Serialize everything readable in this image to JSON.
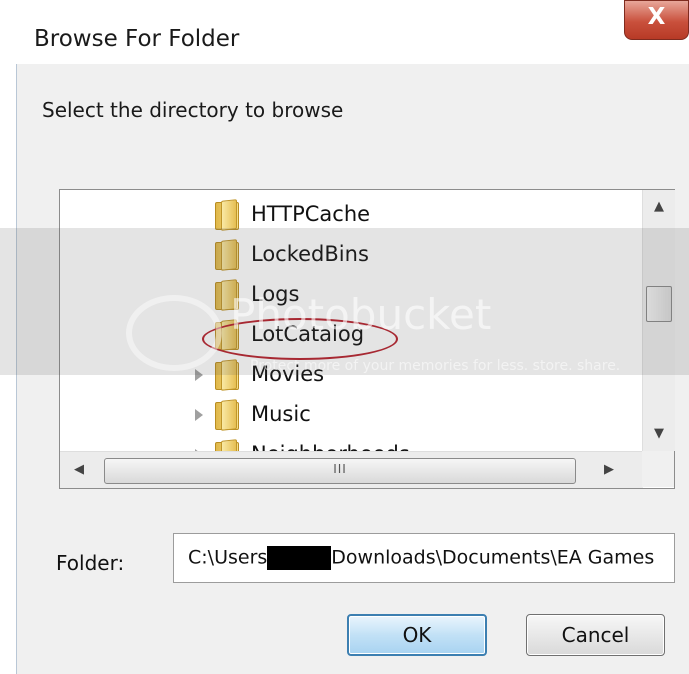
{
  "window": {
    "title": "Browse For Folder",
    "close_glyph": "X"
  },
  "prompt": "Select the directory to browse",
  "tree": {
    "items": [
      {
        "label": "HTTPCache",
        "icon": "folder-icon",
        "expandable": false
      },
      {
        "label": "LockedBins",
        "icon": "folder-icon",
        "expandable": false
      },
      {
        "label": "Logs",
        "icon": "folder-icon",
        "expandable": false
      },
      {
        "label": "LotCatalog",
        "icon": "folder-icon",
        "expandable": false,
        "circled": true
      },
      {
        "label": "Movies",
        "icon": "folder-icon",
        "expandable": true
      },
      {
        "label": "Music",
        "icon": "folder-icon",
        "expandable": true
      },
      {
        "label": "Neighborhoods",
        "icon": "folder-icon",
        "expandable": true
      }
    ],
    "vscroll_up": "▲",
    "vscroll_down": "▼",
    "hscroll_left": "◀",
    "hscroll_right": "▶",
    "hscroll_grip": "III"
  },
  "folder_field": {
    "label": "Folder:",
    "value_before": "C:\\Users",
    "value_after": "Downloads\\Documents\\EA Games"
  },
  "buttons": {
    "ok": "OK",
    "cancel": "Cancel"
  },
  "watermark": {
    "text": "Photobucket",
    "sub": "Protect more of your memories for less. store. share."
  },
  "colors": {
    "close_button": "#c9503c",
    "ok_border": "#3c7fb1",
    "highlight_ellipse": "#b7202b"
  }
}
